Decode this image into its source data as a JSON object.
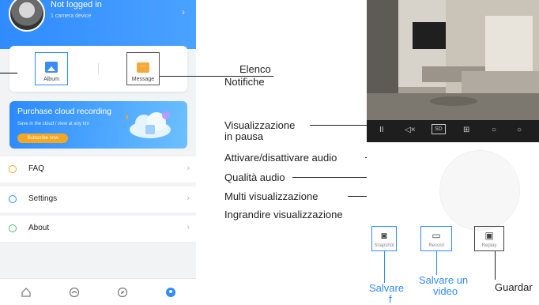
{
  "left_app": {
    "header": {
      "title": "Not logged in",
      "subtitle": "1 camera device"
    },
    "quick": {
      "album": "Album",
      "message": "Message"
    },
    "banner": {
      "title": "Purchase cloud recording",
      "subtitle": "Save in the cloud / view at any tim",
      "button": "Subscribe now"
    },
    "menu": [
      {
        "label": "FAQ",
        "icon": "question-icon",
        "color": "#f5a623"
      },
      {
        "label": "Settings",
        "icon": "gear-icon",
        "color": "#2f8bff"
      },
      {
        "label": "About",
        "icon": "info-icon",
        "color": "#4cbf7a"
      }
    ],
    "tabs": [
      "home-icon",
      "cloud-icon",
      "compass-icon",
      "profile-icon"
    ]
  },
  "annotations": {
    "elenco": "Elenco",
    "notifiche": "Notifiche",
    "pausa1": "Visualizzazione",
    "pausa2": "in pausa",
    "audio": "Attivare/disattivare audio",
    "qualita": "Qualità audio",
    "multi": "Multi visualizzazione",
    "ingrandire": "Ingrandire visualizzazione",
    "salvare_foto": "Salvare",
    "salvare_foto2": "f",
    "salvare_video1": "Salvare un",
    "salvare_video2": "video",
    "guardare": "Guardar"
  },
  "right_app": {
    "controls": {
      "pause": "II",
      "mute": "◁×",
      "sd": "SD",
      "multi": "⊞"
    },
    "actions": {
      "snapshot": "Snapshot",
      "record": "Record",
      "replay": "Replay"
    }
  },
  "colors": {
    "accent": "#2f8bff",
    "orange": "#f5a623",
    "annotation_blue": "#2f8bff"
  }
}
